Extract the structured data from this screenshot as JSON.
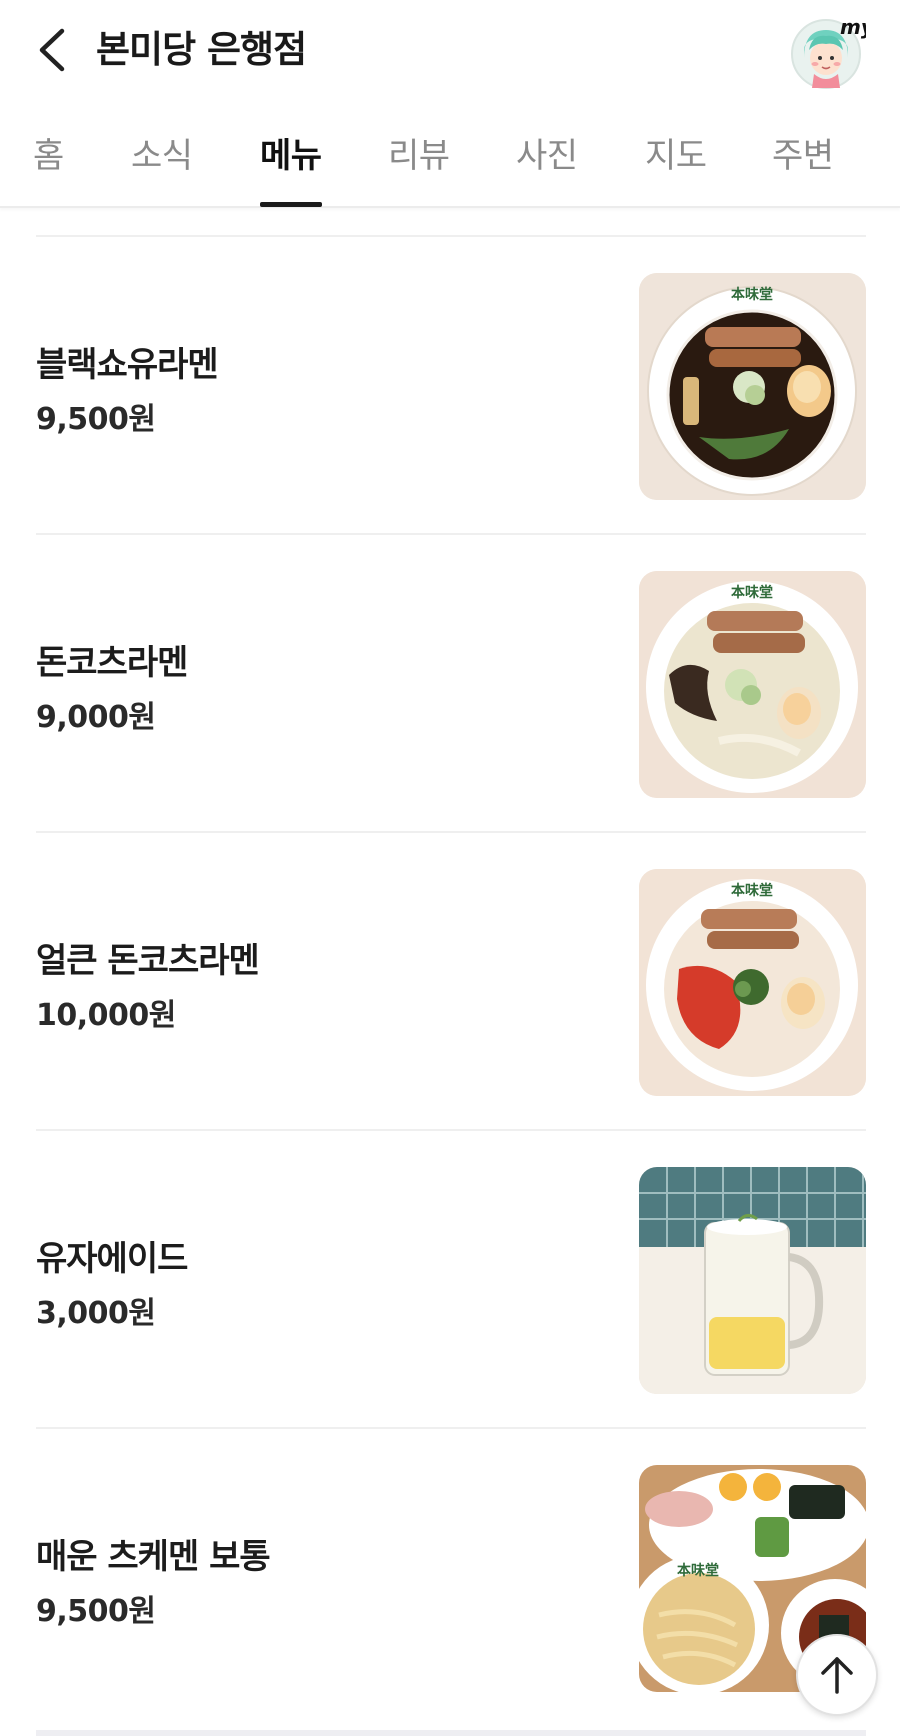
{
  "header": {
    "title": "본미당 은행점",
    "avatar_label": "my"
  },
  "tabs": [
    {
      "label": "홈"
    },
    {
      "label": "소식"
    },
    {
      "label": "메뉴",
      "active": true
    },
    {
      "label": "리뷰"
    },
    {
      "label": "사진"
    },
    {
      "label": "지도"
    },
    {
      "label": "주변"
    }
  ],
  "menu": {
    "items": [
      {
        "name": "블랙쇼유라멘",
        "price": "9,500원",
        "image": "black-shoyu-ramen-bowl"
      },
      {
        "name": "돈코츠라멘",
        "price": "9,000원",
        "image": "tonkotsu-ramen-bowl"
      },
      {
        "name": "얼큰 돈코츠라멘",
        "price": "10,000원",
        "image": "spicy-tonkotsu-ramen-bowl"
      },
      {
        "name": "유자에이드",
        "price": "3,000원",
        "image": "yuzu-ade-glass"
      },
      {
        "name": "매운 츠케멘 보통",
        "price": "9,500원",
        "image": "spicy-tsukemen-set"
      }
    ]
  },
  "icons": {
    "back": "chevron-left-icon",
    "scroll_top": "arrow-up-icon"
  },
  "colors": {
    "active_tab": "#111111",
    "inactive_tab": "#8a8a8a",
    "divider": "#efefef"
  }
}
